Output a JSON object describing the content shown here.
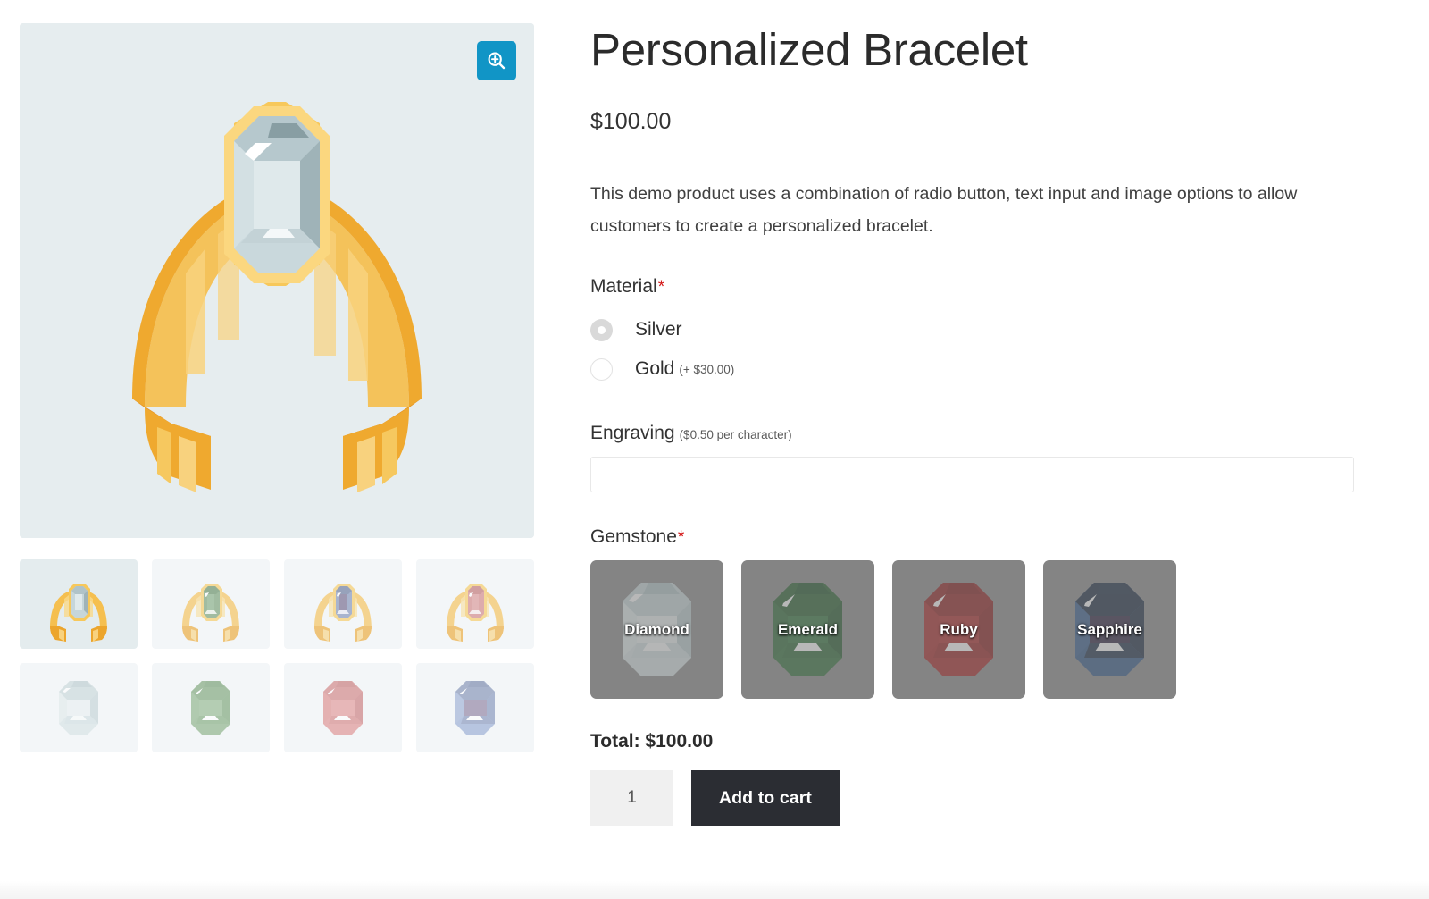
{
  "product": {
    "title": "Personalized Bracelet",
    "price": "$100.00",
    "description": "This demo product uses a combination of radio button, text input and image options to allow customers to create a personalized bracelet."
  },
  "gallery": {
    "zoom_button_icon": "magnifier-plus-icon",
    "main_image_alt": "gold cuff bracelet with diamond gemstone",
    "thumbnails": [
      {
        "name": "bracelet-diamond",
        "kind": "bracelet",
        "gem": "diamond",
        "active": true
      },
      {
        "name": "bracelet-emerald",
        "kind": "bracelet",
        "gem": "emerald",
        "active": false
      },
      {
        "name": "bracelet-sapphire",
        "kind": "bracelet",
        "gem": "sapphire",
        "active": false
      },
      {
        "name": "bracelet-ruby",
        "kind": "bracelet",
        "gem": "ruby",
        "active": false
      },
      {
        "name": "gem-diamond",
        "kind": "gem",
        "gem": "diamond",
        "active": false
      },
      {
        "name": "gem-emerald",
        "kind": "gem",
        "gem": "emerald",
        "active": false
      },
      {
        "name": "gem-ruby",
        "kind": "gem",
        "gem": "ruby",
        "active": false
      },
      {
        "name": "gem-sapphire",
        "kind": "gem",
        "gem": "sapphire",
        "active": false
      }
    ]
  },
  "options": {
    "material": {
      "label": "Material",
      "required_marker": "*",
      "choices": [
        {
          "label": "Silver",
          "note": "",
          "selected": true
        },
        {
          "label": "Gold",
          "note": "(+ $30.00)",
          "selected": false
        }
      ]
    },
    "engraving": {
      "label": "Engraving",
      "note": "($0.50 per character)",
      "value": "",
      "placeholder": ""
    },
    "gemstone": {
      "label": "Gemstone",
      "required_marker": "*",
      "choices": [
        {
          "label": "Diamond",
          "selected": false
        },
        {
          "label": "Emerald",
          "selected": false
        },
        {
          "label": "Ruby",
          "selected": false
        },
        {
          "label": "Sapphire",
          "selected": false
        }
      ]
    }
  },
  "purchase": {
    "total_label": "Total: $100.00",
    "quantity": "1",
    "add_to_cart_label": "Add to cart"
  },
  "colors": {
    "accent_zoom": "#1195c6",
    "button_dark": "#2b2d33",
    "required_star": "#d41919",
    "image_bg": "#e6edef",
    "thumb_bg": "#f3f6f8",
    "thumb_bg_active": "#e4ecee",
    "swatch_overlay": "#808080",
    "gold": "#f5b335",
    "diamond": "#c9d8dc",
    "emerald": "#1e5a2a",
    "ruby": "#9b1b1b",
    "sapphire": "#1d3b61"
  }
}
